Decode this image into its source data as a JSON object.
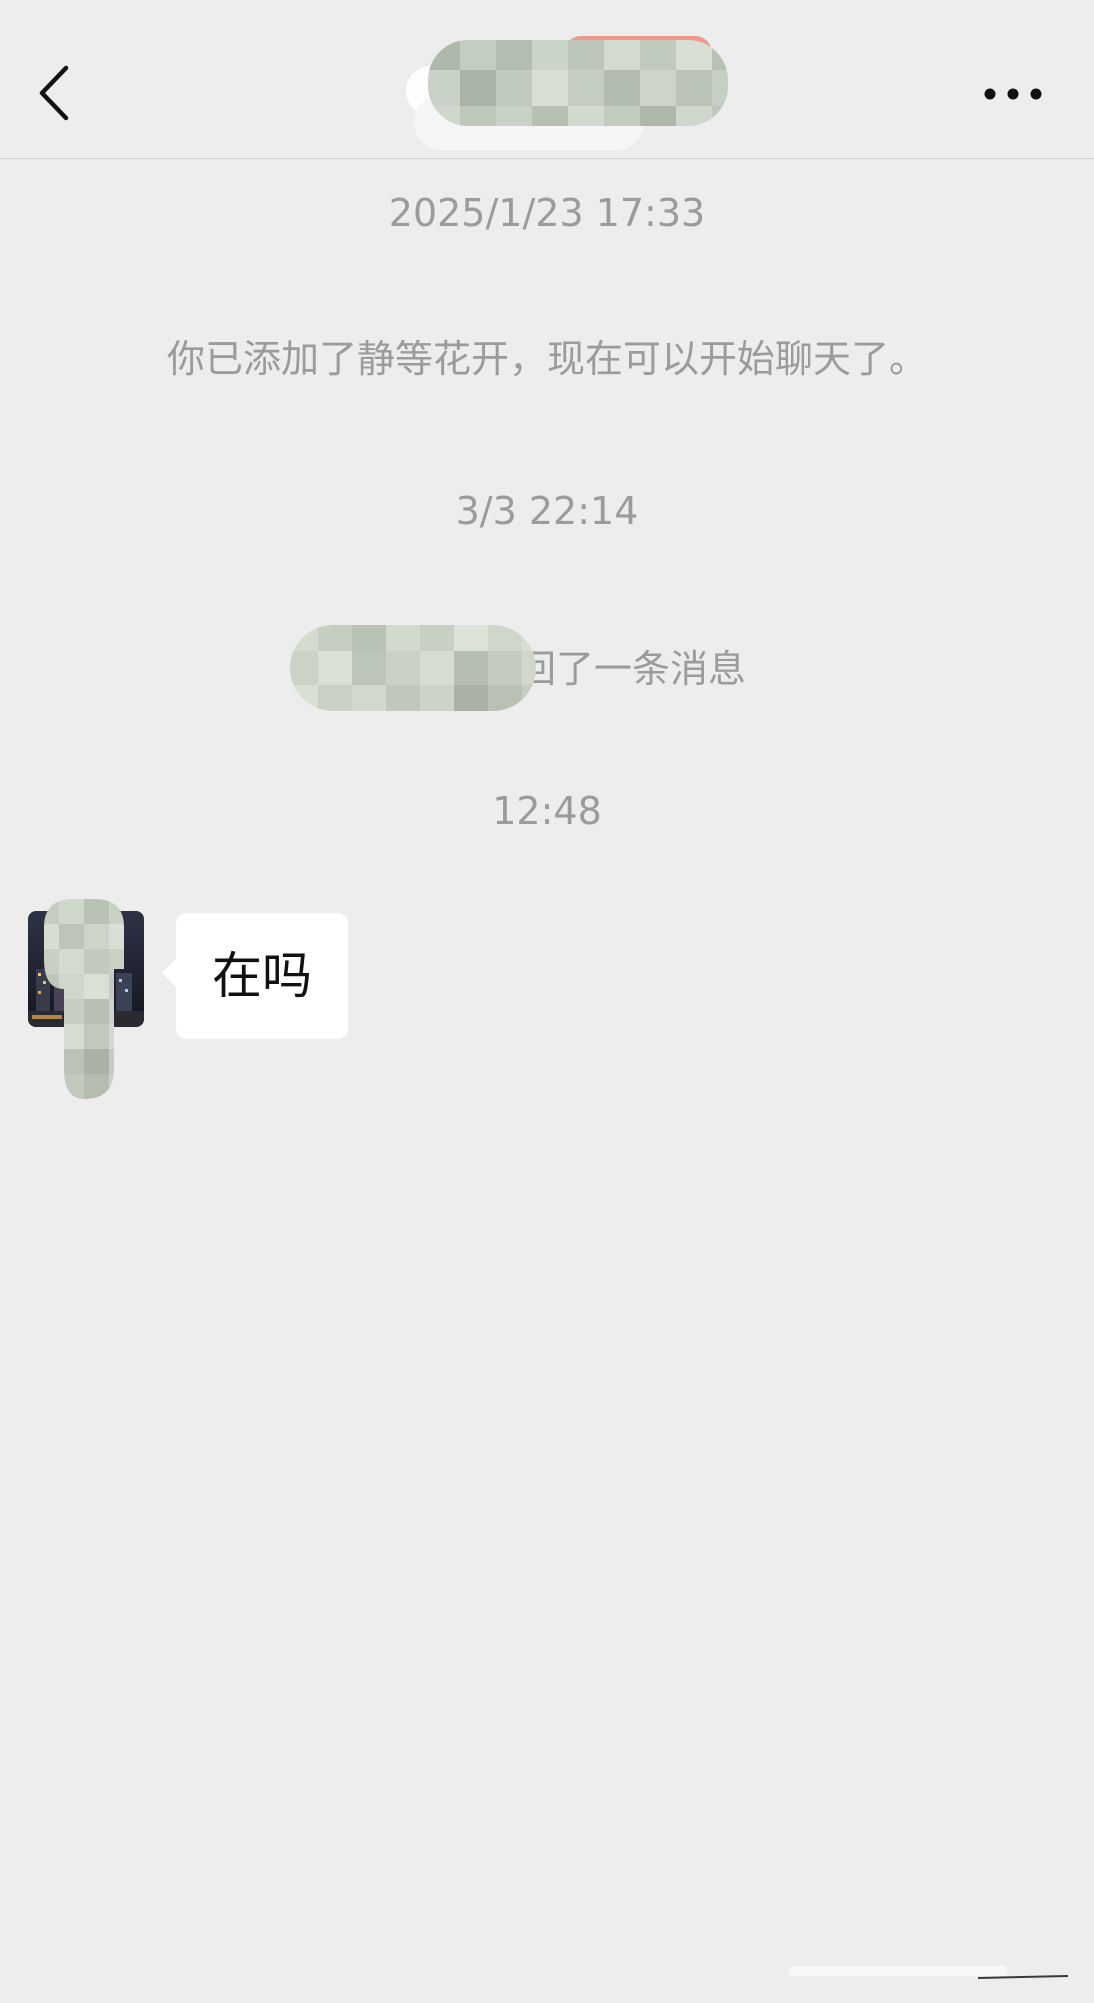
{
  "header": {
    "back_icon": "chevron-left-icon",
    "more_icon": "ellipsis-icon"
  },
  "chat": {
    "timestamp_1": "2025/1/23 17:33",
    "added_notice": "你已添加了静等花开，现在可以开始聊天了。",
    "timestamp_2": "3/3 22:14",
    "recall_notice": "撤回了一条消息",
    "timestamp_3": "12:48",
    "messages": [
      {
        "text": "在吗"
      }
    ]
  },
  "colors": {
    "background": "#ededed",
    "system_text": "#9b9b9b",
    "bubble": "#ffffff",
    "message_text": "#111111"
  }
}
